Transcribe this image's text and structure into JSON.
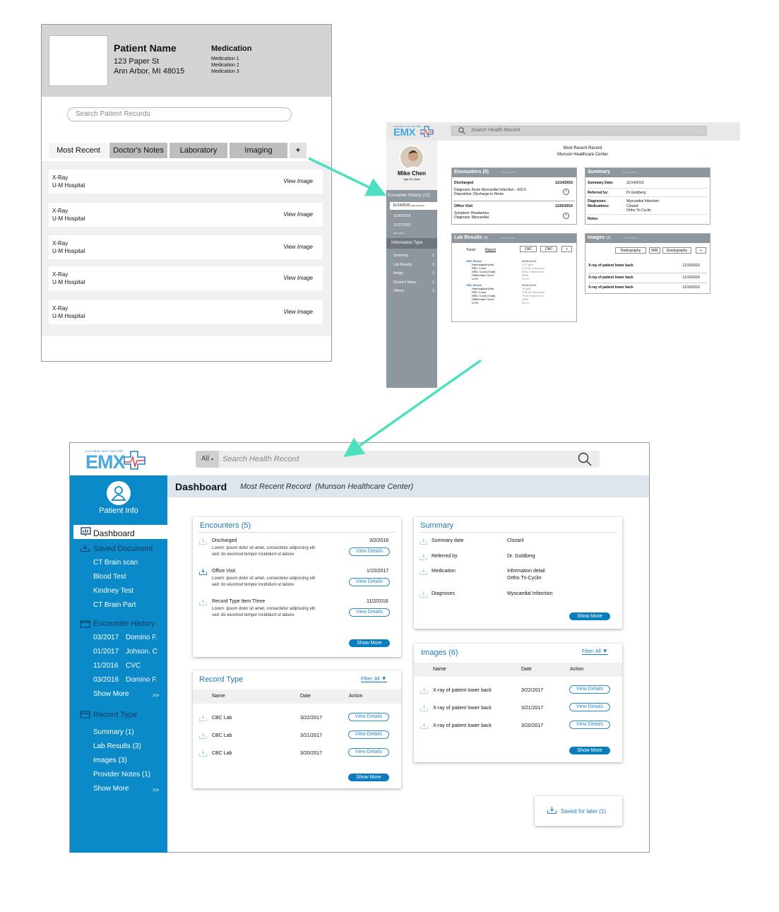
{
  "wireframe": {
    "patient_name": "Patient Name",
    "address_line1": "123 Paper St",
    "address_line2": "Ann Arbor, MI 48015",
    "medication_title": "Medication",
    "medications": [
      "Medication 1",
      "Medication 2",
      "Medication 3"
    ],
    "search_placeholder": "Search Patient Records",
    "tabs": [
      "Most Recent",
      "Doctor's Notes",
      "Laboratory",
      "Imaging",
      "+"
    ],
    "rows": [
      {
        "type": "X-Ray",
        "hospital": "U-M Hospital",
        "action": "View Image"
      },
      {
        "type": "X-Ray",
        "hospital": "U-M Hospital",
        "action": "View Image"
      },
      {
        "type": "X-Ray",
        "hospital": "U-M Hospital",
        "action": "View Image"
      },
      {
        "type": "X-Ray",
        "hospital": "U-M Hospital",
        "action": "View Image"
      },
      {
        "type": "X-Ray",
        "hospital": "U-M Hospital",
        "action": "View Image"
      }
    ]
  },
  "midfi": {
    "logo_tagline": "FLEXIBLE FAST SECURE",
    "logo": "EMX",
    "search_placeholder": "Search Health Record",
    "patient_name": "Mike Chen",
    "patient_sub": "Age 50, Male",
    "encounter_history": "Encounter History (12)",
    "history_items": [
      "11/14/2016",
      "11/05/2016",
      "11/27/2015"
    ],
    "most_recent_tag": "(Most Recent)",
    "history_more": "Show More",
    "info_type": "Information Type",
    "info_items": [
      {
        "label": "Summary",
        "count": "1"
      },
      {
        "label": "Lab Results",
        "count": "3"
      },
      {
        "label": "Image",
        "count": "2"
      },
      {
        "label": "Doctor's Notes",
        "count": "1"
      },
      {
        "label": "Others",
        "count": "3"
      }
    ],
    "center_title": "Most Recent Record",
    "center_sub": "Munson Healthcare Center",
    "show_more": "Show More",
    "encounters": {
      "title": "Encounters (5)",
      "items": [
        {
          "name": "Discharged",
          "date": "11/14/2016",
          "line1": "Diagnosis: Acute Myocardial Infarction - 410.9",
          "line2": "Disposition: Discharge to Home"
        },
        {
          "name": "Office Visit",
          "date": "11/05/2016",
          "line1": "Symptom: Headaches",
          "line2": "Diagnosis: Myocardial"
        }
      ]
    },
    "summary": {
      "title": "Summary",
      "rows": [
        {
          "k": "Summary Date:",
          "v": "11/14/2016"
        },
        {
          "k": "Referred by:",
          "v": "Dr Goldberg"
        },
        {
          "k": "Diagnoses:",
          "v": "Myocardial Infarction"
        },
        {
          "k": "Medications:",
          "v": "Clozaril"
        },
        {
          "k": "",
          "v": "Ortho Tri-Cyclin"
        },
        {
          "k": "Notes:",
          "v": ""
        }
      ]
    },
    "labs": {
      "title": "Lab Results",
      "count": "(4)",
      "tabs": [
        "Trend",
        "Report",
        "CBC",
        "CBC",
        "+"
      ],
      "results": [
        {
          "name": "CBC Result",
          "date": "2015-02-01",
          "rows": [
            [
              "Haemoglobin(Hb)",
              "14.2 g/dL"
            ],
            [
              "RBC Count",
              "3.95 M.Cell/cumm"
            ],
            [
              "WBC Count (Total)",
              "8000 Cells/cumm"
            ],
            [
              "Differential Count",
              "4500"
            ],
            [
              "LIVG",
              "No %"
            ]
          ]
        },
        {
          "name": "CBC Result",
          "date": "2015-04-01",
          "rows": [
            [
              "Haemoglobin(Hb)",
              "15 g/dL"
            ],
            [
              "RBC Count",
              "3.95 M.Cell/cumm"
            ],
            [
              "WBC Count (Total)",
              "7500 Cells/cumm"
            ],
            [
              "Differential Count",
              "4000"
            ],
            [
              "LIVG",
              "No %"
            ]
          ]
        }
      ]
    },
    "images": {
      "title": "Images",
      "count": "(3)",
      "tabs": [
        "Radiography",
        "MRI",
        "Elastography",
        "+"
      ],
      "rows": [
        {
          "name": "X-ray of patient lower back",
          "date": "11/10/2016"
        },
        {
          "name": "X-ray of patient lower back",
          "date": "11/10/2016"
        },
        {
          "name": "X-ray of patient lower back",
          "date": "11/10/2016"
        }
      ]
    }
  },
  "dashboard": {
    "logo_tagline": "FLEXIBLE FAST SECURE",
    "logo": "EMX",
    "search_scope": "All",
    "search_placeholder": "Search Health Record",
    "patient_info": "Patient Info",
    "nav": {
      "dashboard": "Dashboard",
      "saved_document": "Saved Document",
      "saved_items": [
        "CT Brain scan",
        "Blood Test",
        "Kindney Test",
        "CT Brain Part"
      ],
      "encounter_history": "Encounter History",
      "encounters": [
        {
          "date": "03/2017",
          "name": "Domino F."
        },
        {
          "date": "01/2017",
          "name": "Johson. C"
        },
        {
          "date": "11/2016",
          "name": "CVC"
        },
        {
          "date": "03/2016",
          "name": "Domino F."
        }
      ],
      "show_more": "Show More",
      "more_arrows": ">>",
      "record_type": "Record Type",
      "record_items": [
        "Summary (1)",
        "Lab Results (3)",
        "Images (3)",
        "Provider Notes (1)"
      ]
    },
    "title": "Dashboard",
    "subtitle": "Most Recent Record  (Munson Healthcare Center)",
    "view_details": "View Details",
    "show_more": "Show More",
    "encounters": {
      "title": "Encounters (5)",
      "items": [
        {
          "name": "Discharged",
          "date": "3/2/2016",
          "line1": "Lorem: ipsum dolor sit amet, consectetur adipiscing elit",
          "line2": "sed: do eiusmod tempor incididunt ut labore"
        },
        {
          "name": "Office Visit",
          "date": "1/15/2017",
          "line1": "Lorem: ipsum dolor sit amet, consectetur adipiscing elit",
          "line2": "sed: do eiusmod tempor incididunt ut labore"
        },
        {
          "name": "Record Type Item Three",
          "date": "11/2/2016",
          "line1": "Lorem: ipsum dolor sit amet, consectetur adipiscing elit",
          "line2": "sed: do eiusmod tempor incididunt ut labore"
        }
      ]
    },
    "summary": {
      "title": "Summary",
      "rows": [
        {
          "k": "Summary date",
          "v": "Clozaril",
          "v2": ""
        },
        {
          "k": "Referred by",
          "v": "Dr. Goldberg",
          "v2": ""
        },
        {
          "k": "Medication",
          "v": "Information detail",
          "v2": "Ortho Tri-Cyclin"
        },
        {
          "k": "Diagnoses",
          "v": "Myocardial Infarction",
          "v2": ""
        }
      ]
    },
    "record_type": {
      "title": "Record Type",
      "filter": "Filter: All",
      "cols": [
        "Name",
        "Date",
        "Action"
      ],
      "rows": [
        {
          "name": "CBC Lab",
          "date": "3/22/2017"
        },
        {
          "name": "CBC Lab",
          "date": "3/21/2017"
        },
        {
          "name": "CBC Lab",
          "date": "3/20/2017"
        }
      ]
    },
    "images": {
      "title": "Images (6)",
      "filter": "Filter: All",
      "cols": [
        "Name",
        "Date",
        "Action"
      ],
      "rows": [
        {
          "name": "X-ray of patient lower back",
          "date": "3/22/2017"
        },
        {
          "name": "X-ray of patient lower back",
          "date": "3/21/2017"
        },
        {
          "name": "X-ray of patient lower back",
          "date": "3/20/2017"
        }
      ]
    },
    "saved_later": "Saved for later (1)"
  },
  "colors": {
    "accent": "#0a8ac8",
    "arrow": "#4de0c0",
    "panel_header": "#8e979e"
  }
}
